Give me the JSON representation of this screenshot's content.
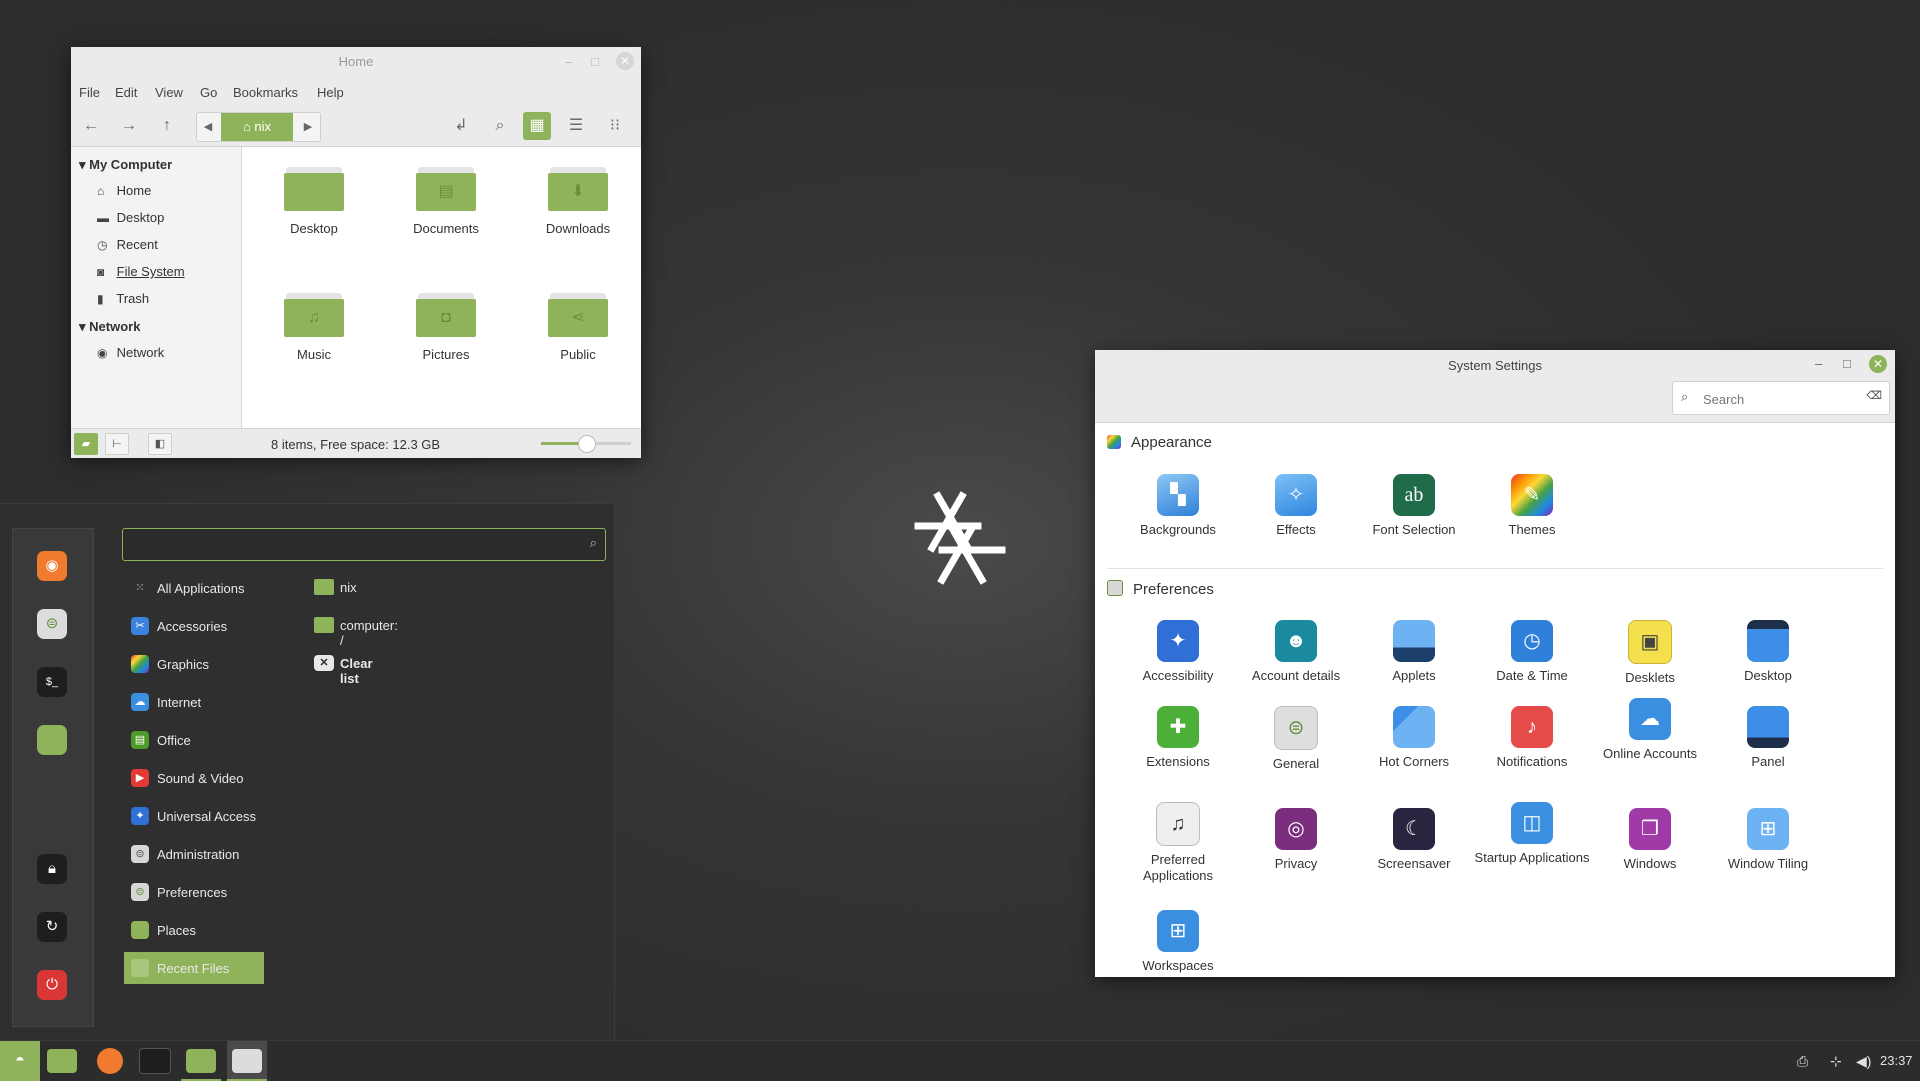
{
  "file_manager": {
    "title": "Home",
    "menu": [
      "File",
      "Edit",
      "View",
      "Go",
      "Bookmarks",
      "Help"
    ],
    "breadcrumb_current": "nix",
    "sidebar": {
      "sections": [
        {
          "heading": "My Computer",
          "items": [
            "Home",
            "Desktop",
            "Recent",
            "File System",
            "Trash"
          ]
        },
        {
          "heading": "Network",
          "items": [
            "Network"
          ]
        }
      ]
    },
    "folders": [
      "Desktop",
      "Documents",
      "Downloads",
      "Music",
      "Pictures",
      "Public"
    ],
    "status_text": "8 items, Free space: 12.3 GB",
    "zoom_level": 0.5
  },
  "menu": {
    "search_value": "",
    "categories": [
      "All Applications",
      "Accessories",
      "Graphics",
      "Internet",
      "Office",
      "Sound & Video",
      "Universal Access",
      "Administration",
      "Preferences",
      "Places",
      "Recent Files"
    ],
    "selected_category": "Recent Files",
    "recent": [
      "nix",
      "computer: /",
      "Clear list"
    ]
  },
  "settings": {
    "title": "System Settings",
    "search_placeholder": "Search",
    "sections": [
      {
        "heading": "Appearance",
        "items": [
          "Backgrounds",
          "Effects",
          "Font Selection",
          "Themes"
        ]
      },
      {
        "heading": "Preferences",
        "items": [
          "Accessibility",
          "Account details",
          "Applets",
          "Date & Time",
          "Desklets",
          "Desktop",
          "Extensions",
          "General",
          "Hot Corners",
          "Notifications",
          "Online Accounts",
          "Panel",
          "Preferred Applications",
          "Privacy",
          "Screensaver",
          "Startup Applications",
          "Windows",
          "Window Tiling",
          "Workspaces"
        ]
      }
    ]
  },
  "taskbar": {
    "clock": "23:37"
  },
  "colors": {
    "accent": "#8fb35b",
    "panel": "#2c2c2c"
  }
}
